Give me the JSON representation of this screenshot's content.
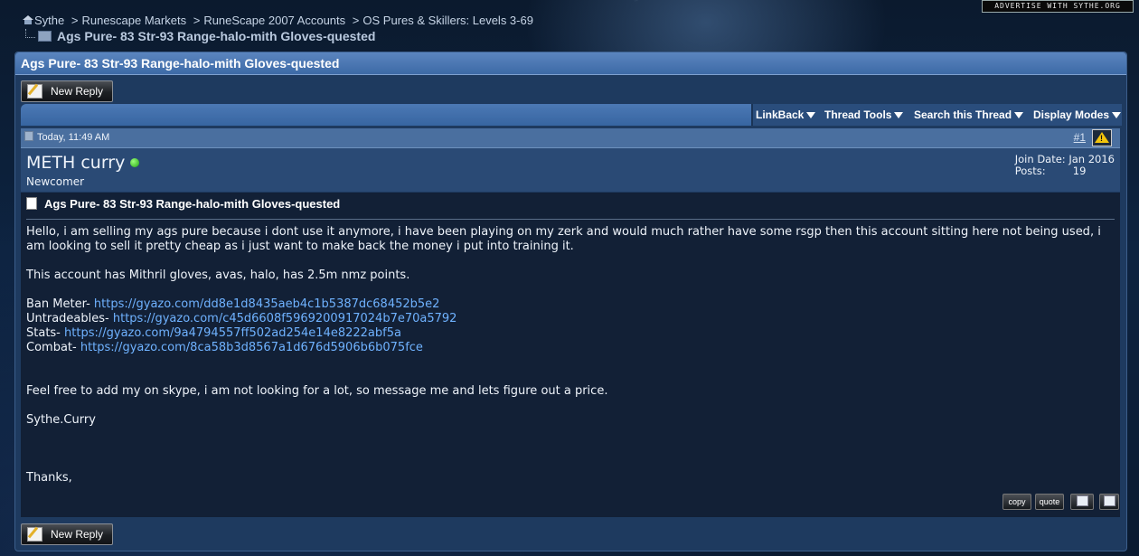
{
  "advert": "ADVERTISE WITH SYTHE.ORG",
  "breadcrumb": {
    "items": [
      "Sythe",
      "Runescape Markets",
      "RuneScape 2007 Accounts",
      "OS Pures & Skillers: Levels 3-69"
    ],
    "separator": ">",
    "current": "Ags Pure- 83 Str-93 Range-halo-mith Gloves-quested"
  },
  "thread": {
    "title": "Ags Pure- 83 Str-93 Range-halo-mith Gloves-quested",
    "new_reply_label": "New Reply"
  },
  "tools": {
    "linkback": "LinkBack",
    "thread_tools": "Thread Tools",
    "search_thread": "Search this Thread",
    "display_modes": "Display Modes"
  },
  "post": {
    "date": "Today, 11:49 AM",
    "number": "#1",
    "username": "METH curry",
    "user_title": "Newcomer",
    "join_label": "Join Date:",
    "join_value": "Jan 2016",
    "posts_label": "Posts:",
    "posts_value": "19",
    "title": "Ags Pure- 83 Str-93 Range-halo-mith Gloves-quested",
    "para1": "Hello, i am selling my ags pure because i dont use it anymore, i have been playing on my zerk and would much rather have some rsgp then this account sitting here not being used, i am looking to sell it pretty cheap as i just want to make back the money i put into training it.",
    "para2": "This account has Mithril gloves, avas, halo, has 2.5m nmz points.",
    "links": [
      {
        "label": "Ban Meter-",
        "url": "https://gyazo.com/dd8e1d8435aeb4c1b5387dc68452b5e2"
      },
      {
        "label": "Untradeables-",
        "url": "https://gyazo.com/c45d6608f5969200917024b7e70a5792"
      },
      {
        "label": "Stats-",
        "url": "https://gyazo.com/9a4794557ff502ad254e14e8222abf5a"
      },
      {
        "label": "Combat-",
        "url": "https://gyazo.com/8ca58b3d8567a1d676d5906b6b075fce"
      }
    ],
    "para3": "Feel free to add my on skype, i am not looking for a lot, so message me and lets figure out a price.",
    "signature": "Sythe.Curry",
    "closing": "Thanks,",
    "copy_label": "copy",
    "quote_label": "quote"
  }
}
